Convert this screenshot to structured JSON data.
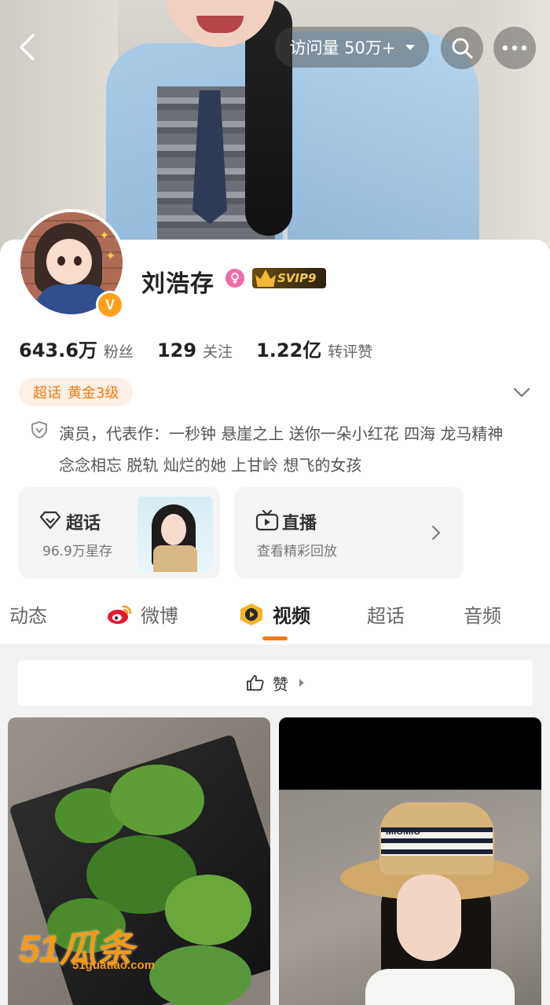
{
  "header": {
    "visits_label": "访问量 50万+",
    "icons": {
      "back": "back-icon",
      "search": "search-icon",
      "more": "more-icon"
    }
  },
  "profile": {
    "name": "刘浩存",
    "gender": "female",
    "vip_badge": "SVIP9",
    "verified_badge": "V",
    "stats": [
      {
        "value": "643.6万",
        "label": "粉丝"
      },
      {
        "value": "129",
        "label": "关注"
      },
      {
        "value": "1.22亿",
        "label": "转评赞"
      }
    ],
    "tag": {
      "prefix": "超话",
      "level": "黄金3级"
    },
    "bio": "演员，代表作：一秒钟 悬崖之上 送你一朵小红花 四海 龙马精神 念念相忘 脱轨 灿烂的她 上甘岭 想飞的女孩"
  },
  "tiles": {
    "supertopic": {
      "title": "超话",
      "sub": "96.9万星存"
    },
    "live": {
      "title": "直播",
      "sub": "查看精彩回放"
    }
  },
  "tabs": [
    {
      "label": "动态"
    },
    {
      "label": "微博"
    },
    {
      "label": "视频",
      "active": true
    },
    {
      "label": "超话"
    },
    {
      "label": "音频"
    }
  ],
  "likes_bar": {
    "label": "赞"
  },
  "videos": [
    {
      "watermark": "51瓜条",
      "watermark_sub": "51guatiao.com"
    },
    {
      "hat_text": "MIUMIU"
    }
  ],
  "colors": {
    "accent": "#f07a14",
    "tag_bg": "#fdf0e6",
    "svip_gold": "#f6c650",
    "gender_pink": "#f06aa8"
  }
}
